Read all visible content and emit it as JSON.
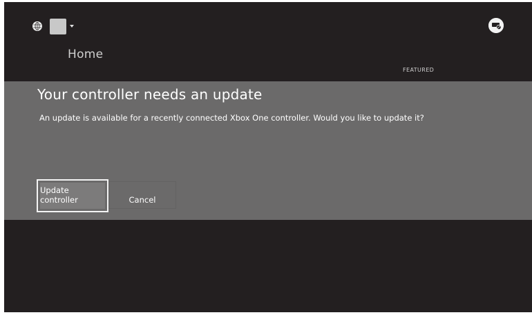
{
  "header": {
    "profile_icon": "globe-icon",
    "avatar_icon": "avatar-placeholder",
    "dropdown_icon": "caret-down-icon",
    "notification_icon": "controller-settings-icon",
    "page_title": "Home",
    "featured_tab": "FEATURED"
  },
  "dialog": {
    "title": "Your controller needs an update",
    "message": "An update is available for a recently connected Xbox One controller. Would you like to update it?",
    "buttons": {
      "primary": "Update controller",
      "secondary": "Cancel"
    }
  },
  "colors": {
    "background": "#231f20",
    "dialog_background": "#6b6a6a",
    "focus_border": "#f4f4f4",
    "text": "#ffffff"
  }
}
